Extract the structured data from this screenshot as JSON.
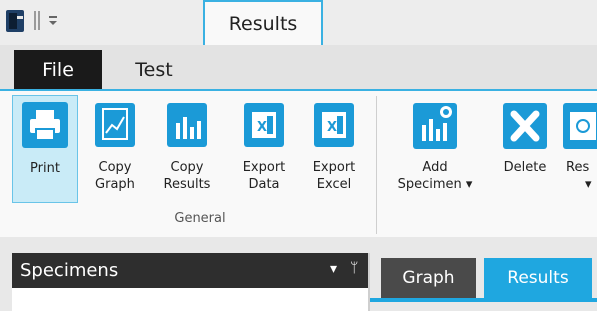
{
  "titlebar": {
    "quick_access_icons": [
      "app-icon",
      "separator-icon",
      "customize-arrow-icon"
    ]
  },
  "tabs": [
    {
      "label": "File",
      "active": false
    },
    {
      "label": "Test",
      "active": false
    },
    {
      "label": "Results",
      "active": true
    }
  ],
  "ribbon": {
    "buttons": [
      {
        "label": "Print",
        "icon": "print-icon"
      },
      {
        "label": "Copy\nGraph",
        "icon": "copy-graph-icon"
      },
      {
        "label": "Copy\nResults",
        "icon": "copy-results-icon"
      },
      {
        "label": "Export\nData",
        "icon": "excel-icon"
      },
      {
        "label": "Export\nExcel",
        "icon": "excel-icon"
      },
      {
        "label": "Add\nSpecimen ▾",
        "icon": "add-specimen-icon"
      },
      {
        "label": "Delete",
        "icon": "delete-icon"
      },
      {
        "label": "Res",
        "icon": "reset-icon"
      }
    ],
    "group_label": "General"
  },
  "specimens_panel": {
    "title": "Specimens",
    "dropdown_glyph": "▾",
    "pin_glyph": "ᛘ"
  },
  "view_tabs": [
    {
      "label": "Graph",
      "active": false
    },
    {
      "label": "Results",
      "active": true
    }
  ],
  "colors": {
    "accent": "#1fa7e0",
    "dark_tab": "#1a1a1a",
    "panel_header": "#2e2e2e"
  }
}
